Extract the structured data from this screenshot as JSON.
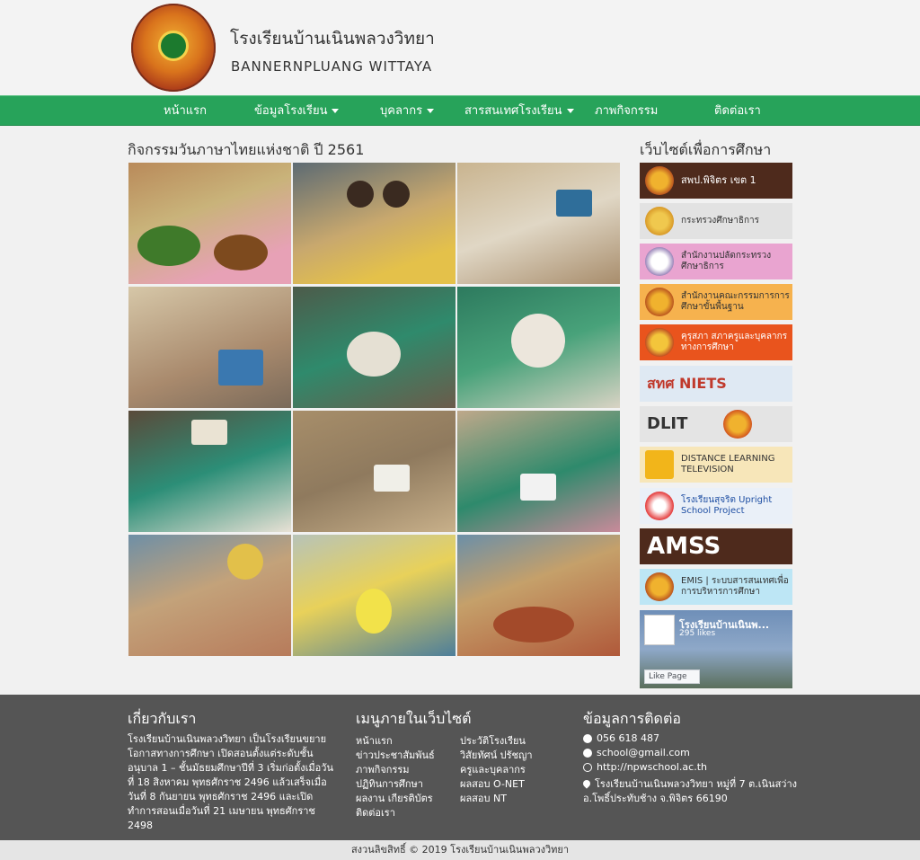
{
  "header": {
    "school_name_th": "โรงเรียนบ้านเนินพลวงวิทยา",
    "school_name_en": "BANNERNPLUANG WITTAYA"
  },
  "nav": {
    "items": [
      {
        "label": "หน้าแรก",
        "dropdown": false
      },
      {
        "label": "ข้อมูลโรงเรียน",
        "dropdown": true
      },
      {
        "label": "บุคลากร",
        "dropdown": true
      },
      {
        "label": "สารสนเทศโรงเรียน",
        "dropdown": true
      },
      {
        "label": "ภาพกิจกรรม",
        "dropdown": false
      },
      {
        "label": "ติดต่อเรา",
        "dropdown": false
      }
    ],
    "bg_color": "#27a35a"
  },
  "gallery": {
    "title": "กิจกรรมวันภาษาไทยแห่งชาติ ปี 2561",
    "photo_count": 12
  },
  "sidebar": {
    "title": "เว็บไซต์เพื่อการศึกษา",
    "banners": [
      {
        "label": "สพป.พิจิตร เขต 1",
        "bg": "#4e2a1c",
        "fg": "#ffffff"
      },
      {
        "label": "กระทรวงศึกษาธิการ",
        "bg": "#e2e2e2",
        "fg": "#333333"
      },
      {
        "label": "สำนักงานปลัดกระทรวงศึกษาธิการ",
        "bg": "#e9a4d0",
        "fg": "#333333"
      },
      {
        "label": "สำนักงานคณะกรรมการการศึกษาขั้นพื้นฐาน",
        "bg": "#f6b24e",
        "fg": "#333333"
      },
      {
        "label": "คุรุสภา สภาครูและบุคลากรทางการศึกษา",
        "bg": "#e9541d",
        "fg": "#ffffff"
      },
      {
        "label": "สทศ NIETS",
        "bg": "#dfe9f3",
        "fg": "#c0392b"
      },
      {
        "label": "DLIT",
        "bg": "#e4e4e4",
        "fg": "#333333"
      },
      {
        "label": "DISTANCE LEARNING TELEVISION",
        "bg": "#f7e6b9",
        "fg": "#333333"
      },
      {
        "label": "โรงเรียนสุจริต Upright School Project",
        "bg": "#eaf0f8",
        "fg": "#1f4fa3"
      },
      {
        "label": "AMSS",
        "bg": "#4e2a1c",
        "fg": "#ffffff"
      },
      {
        "label": "EMIS | ระบบสารสนเทศเพื่อการบริหารการศึกษา",
        "bg": "#bde6f5",
        "fg": "#333333"
      }
    ],
    "facebook": {
      "page_name": "โรงเรียนบ้านเนินพ...",
      "likes": "295 likes",
      "like_button": "Like Page"
    }
  },
  "footer": {
    "about": {
      "title": "เกี่ยวกับเรา",
      "text": "โรงเรียนบ้านเนินพลวงวิทยา เป็นโรงเรียนขยายโอกาสทางการศึกษา เปิดสอนตั้งแต่ระดับชั้น อนุบาล 1 – ชั้นมัธยมศึกษาปีที่ 3 เริ่มก่อตั้งเมื่อวันที่ 18 สิงหาคม พุทธศักราช 2496 แล้วเสร็จเมื่อวันที่ 8 กันยายน พุทธศักราช 2496 และเปิดทำการสอนเมื่อวันที่ 21 เมษายน พุทธศักราช 2498"
    },
    "menu": {
      "title": "เมนูภายในเว็บไซต์",
      "col1": [
        "หน้าแรก",
        "ข่าวประชาสัมพันธ์",
        "ภาพกิจกรรม",
        "ปฏิทินการศึกษา",
        "ผลงาน เกียรติบัตร",
        "ติดต่อเรา"
      ],
      "col2": [
        "ประวัติโรงเรียน",
        "วิสัยทัศน์ ปรัชญา",
        "ครูและบุคลากร",
        "ผลสอบ O-NET",
        "ผลสอบ NT"
      ]
    },
    "contact": {
      "title": "ข้อมูลการติดต่อ",
      "phone": "056 618 487",
      "email": "school@gmail.com",
      "website": "http://npwschool.ac.th",
      "address_line1": "โรงเรียนบ้านเนินพลวงวิทยา หมู่ที่ 7 ต.เนินสว่าง",
      "address_line2": "อ.โพธิ์ประทับช้าง จ.พิจิตร 66190"
    },
    "copyright": "สงวนลิขสิทธิ์ © 2019 โรงเรียนบ้านเนินพลวงวิทยา"
  }
}
